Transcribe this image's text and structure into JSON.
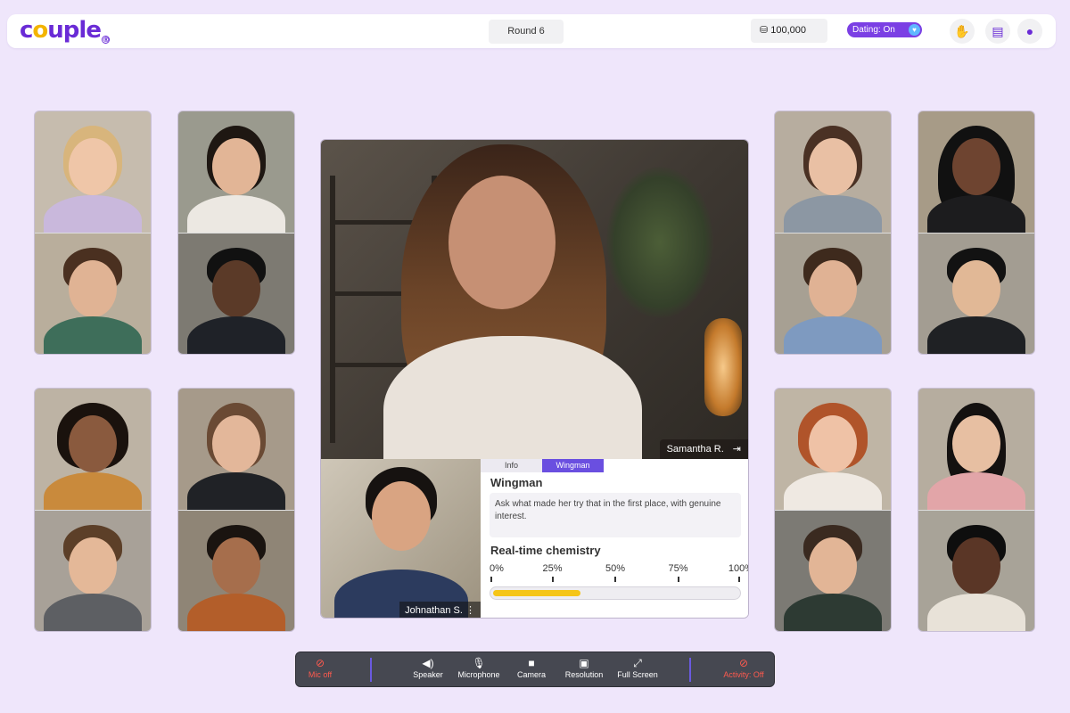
{
  "header": {
    "logo": "couple",
    "round": "Round 6",
    "coins": "100,000",
    "dating": "Dating: On",
    "icons": [
      "handshake-icon",
      "profile-card-icon",
      "user-icon"
    ]
  },
  "main": {
    "partner_name": "Samantha R.",
    "self_name": "Johnathan S.",
    "panel": {
      "tabs": [
        "Info",
        "Wingman"
      ],
      "active_tab": "Wingman",
      "title": "Wingman",
      "tip": "Ask what made her try that in the first place, with genuine interest.",
      "chemistry_title": "Real-time chemistry",
      "ticks": [
        "0%",
        "25%",
        "50%",
        "75%",
        "100%"
      ],
      "chemistry_level": 0.37
    }
  },
  "controls": {
    "mic_off": "Mic off",
    "speaker": "Speaker",
    "microphone": "Microphone",
    "camera": "Camera",
    "resolution": "Resolution",
    "full_screen": "Full Screen",
    "activity_off": "Activity: Off"
  },
  "colors": {
    "brand": "#6a2bd6",
    "accent": "#6a4fe0",
    "chemistry": "#f5c518",
    "alert": "#ff5a4e"
  }
}
